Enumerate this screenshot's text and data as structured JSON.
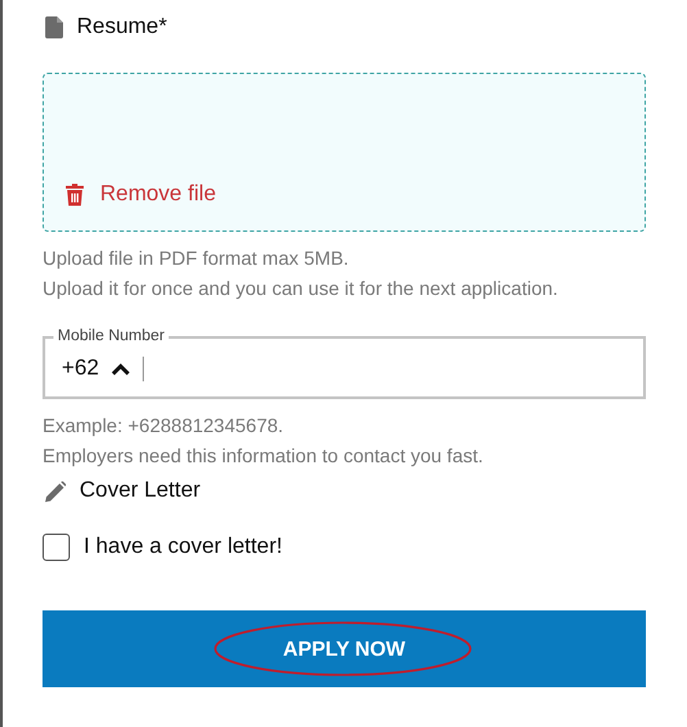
{
  "resume": {
    "label": "Resume*",
    "remove_label": "Remove file",
    "hints": [
      "Upload file in PDF format max 5MB.",
      "Upload it for once and you can use it for the next application."
    ]
  },
  "mobile": {
    "label": "Mobile Number",
    "country_code": "+62",
    "focused": true,
    "hints": [
      "Example: +6288812345678.",
      "Employers need this information to contact you fast."
    ]
  },
  "cover_letter": {
    "label": "Cover Letter",
    "checkbox_label": "I have a cover letter!",
    "checked": false
  },
  "apply_button": {
    "label": "APPLY NOW",
    "circled": true
  }
}
